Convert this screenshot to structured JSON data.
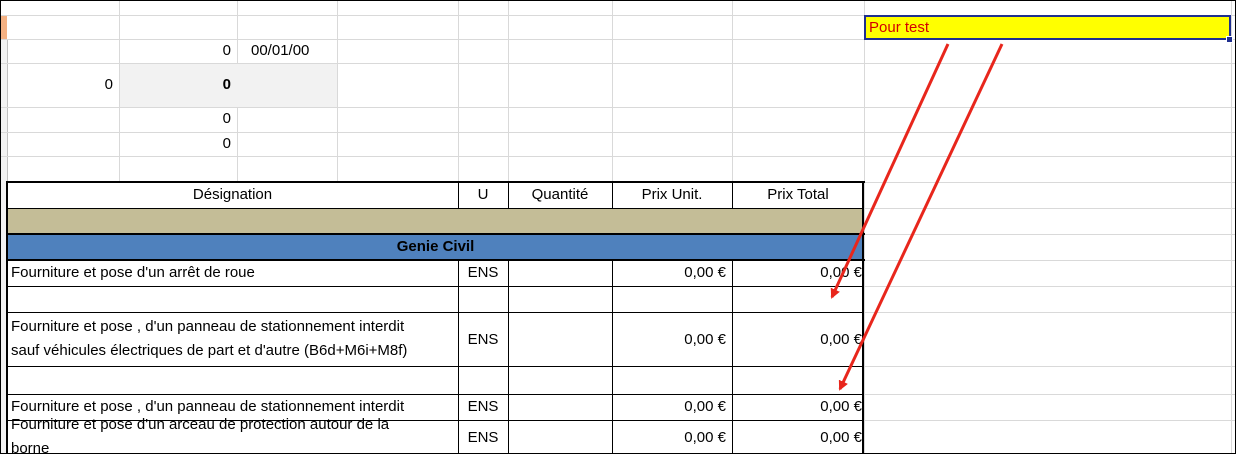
{
  "sheet": {
    "top_cells": {
      "r2_val": "0",
      "r2_date": "00/01/00",
      "r3_left": "0",
      "r3_bold": "0",
      "r4_val": "0",
      "r5_val": "0"
    },
    "header": {
      "designation": "Désignation",
      "unit": "U",
      "quantity": "Quantité",
      "unit_price": "Prix Unit.",
      "total_price": "Prix Total"
    },
    "section_title": "Genie Civil",
    "rows": [
      {
        "designation": "Fourniture et pose d'un arrêt de roue",
        "unit": "ENS",
        "quantity": "",
        "unit_price": "0,00 €",
        "total_price": "0,00 €"
      },
      {
        "designation": "Fourniture et pose , d'un panneau de stationnement interdit",
        "designation_line2": "sauf véhicules électriques de part et d'autre (B6d+M6i+M8f)",
        "unit": "ENS",
        "quantity": "",
        "unit_price": "0,00 €",
        "total_price": "0,00 €"
      },
      {
        "designation": "Fourniture et pose , d'un panneau de stationnement interdit",
        "unit": "ENS",
        "quantity": "",
        "unit_price": "0,00 €",
        "total_price": "0,00 €"
      },
      {
        "designation": "Fourniture et pose d'un arceau de protection autour de la",
        "designation_line2": "borne",
        "unit": "ENS",
        "quantity": "",
        "unit_price": "0,00 €",
        "total_price": "0,00 €"
      }
    ],
    "annotation": {
      "label": "Pour test"
    },
    "colors": {
      "selection_fill": "#ffff00",
      "selection_text": "#d40000",
      "selection_border": "#1f2f8f",
      "section_band": "#c4bd97",
      "section_header": "#4f81bd",
      "arrow": "#e8261c",
      "active_row_header": "#f4b183",
      "highlight_cell": "#f2f2f2"
    }
  }
}
